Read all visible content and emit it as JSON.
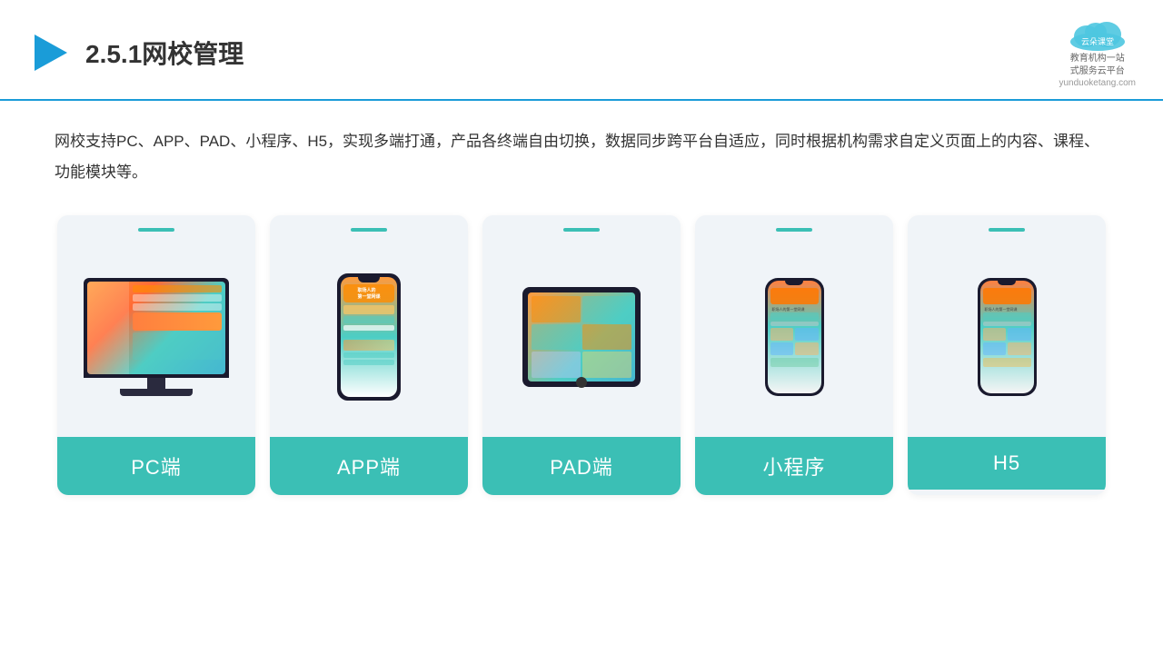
{
  "header": {
    "title": "2.5.1网校管理",
    "logo_name": "云朵课堂",
    "logo_sub": "yunduoketang.com",
    "logo_tagline": "教育机构一站\n式服务云平台"
  },
  "description": "网校支持PC、APP、PAD、小程序、H5，实现多端打通，产品各终端自由切换，数据同步跨平台自适应，同时根据机构需求自定义页面上的内容、课程、功能模块等。",
  "cards": [
    {
      "label": "PC端",
      "type": "pc"
    },
    {
      "label": "APP端",
      "type": "phone"
    },
    {
      "label": "PAD端",
      "type": "tablet"
    },
    {
      "label": "小程序",
      "type": "phone-small"
    },
    {
      "label": "H5",
      "type": "phone-small2"
    }
  ]
}
